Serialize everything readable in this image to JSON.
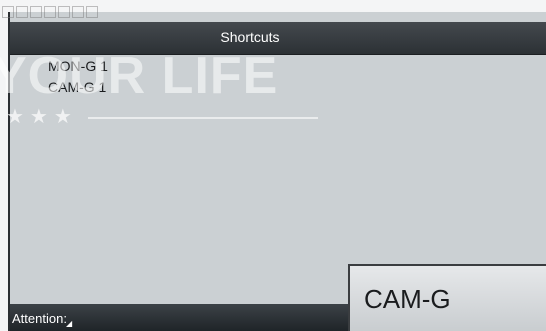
{
  "header": {
    "title": "Shortcuts"
  },
  "shortcuts": {
    "items": [
      {
        "label": "MON-G 1"
      },
      {
        "label": "CAM-G 1"
      }
    ]
  },
  "status": {
    "attention_label": "Attention:"
  },
  "action": {
    "button_label": "CAM-G"
  },
  "watermark": {
    "text": "YOUR LIFE",
    "stars": "★★★"
  },
  "colors": {
    "screen_bg": "#cbd0d3",
    "titlebar": "#3a3f44",
    "statusbar": "#2b3034",
    "button_face": "#dcdfe1"
  },
  "icons": {
    "status_cursor": "pointer-icon"
  }
}
